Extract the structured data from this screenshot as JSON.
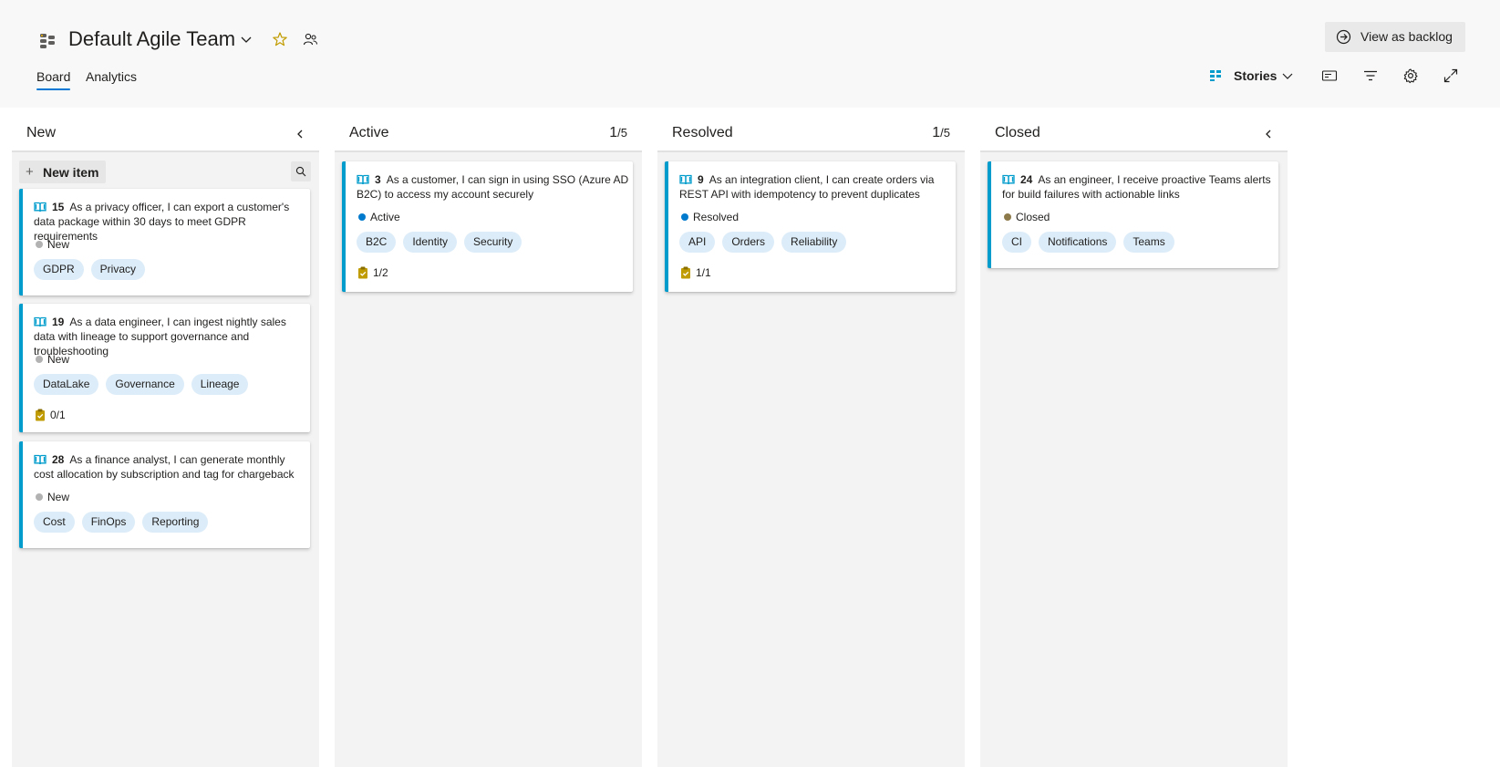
{
  "header": {
    "team_name": "Default Agile Team",
    "tabs": [
      {
        "label": "Board",
        "selected": true
      },
      {
        "label": "Analytics",
        "selected": false
      }
    ],
    "view_backlog_label": "View as backlog",
    "backlog_level_label": "Stories",
    "accent_color": "#0078d4"
  },
  "columns": [
    {
      "title": "New",
      "count": "",
      "limit": "",
      "collapsible": true
    },
    {
      "title": "Active",
      "count": "1",
      "limit": "/5",
      "collapsible": false
    },
    {
      "title": "Resolved",
      "count": "1",
      "limit": "/5",
      "collapsible": false
    },
    {
      "title": "Closed",
      "count": "",
      "limit": "",
      "collapsible": true
    }
  ],
  "new_item_label": "New item",
  "work_item_color": "#009ccc",
  "cards": [
    {
      "id": "15",
      "title": "As a privacy officer, I can export a customer's data package within 30 days to meet GDPR requirements",
      "state": "New",
      "state_color": "#b2b2b2",
      "tags": [
        "GDPR",
        "Privacy"
      ],
      "tasks": ""
    },
    {
      "id": "19",
      "title": "As a data engineer, I can ingest nightly sales data with lineage to support governance and troubleshooting",
      "state": "New",
      "state_color": "#b2b2b2",
      "tags": [
        "DataLake",
        "Governance",
        "Lineage"
      ],
      "tasks": "0/1"
    },
    {
      "id": "28",
      "title": "As a finance analyst, I can generate monthly cost allocation by subscription and tag for chargeback",
      "state": "New",
      "state_color": "#b2b2b2",
      "tags": [
        "Cost",
        "FinOps",
        "Reporting"
      ],
      "tasks": ""
    },
    {
      "id": "3",
      "title": "As a customer, I can sign in using SSO (Azure AD B2C) to access my account securely",
      "state": "Active",
      "state_color": "#007acc",
      "tags": [
        "B2C",
        "Identity",
        "Security"
      ],
      "tasks": "1/2"
    },
    {
      "id": "9",
      "title": "As an integration client, I can create orders via REST API with idempotency to prevent duplicates",
      "state": "Resolved",
      "state_color": "#007acc",
      "tags": [
        "API",
        "Orders",
        "Reliability"
      ],
      "tasks": "1/1"
    },
    {
      "id": "24",
      "title": "As an engineer, I receive proactive Teams alerts for build failures with actionable links",
      "state": "Closed",
      "state_color": "#8c7a4a",
      "tags": [
        "CI",
        "Notifications",
        "Teams"
      ],
      "tasks": ""
    }
  ]
}
